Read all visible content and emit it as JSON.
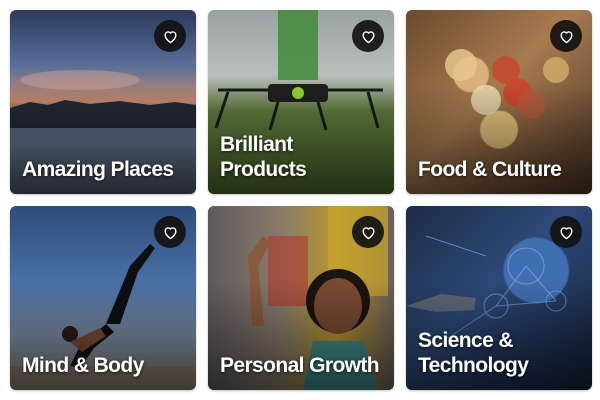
{
  "cards": [
    {
      "title": "Amazing Places"
    },
    {
      "title": "Brilliant Products"
    },
    {
      "title": "Food & Culture"
    },
    {
      "title": "Mind & Body"
    },
    {
      "title": "Personal Growth"
    },
    {
      "title": "Science &\nTechnology"
    }
  ],
  "icons": {
    "favorite": "heart-outline-icon"
  },
  "colors": {
    "title_text": "#ffffff",
    "favorite_button_bg": "#121212",
    "favorite_icon": "#ffffff"
  }
}
